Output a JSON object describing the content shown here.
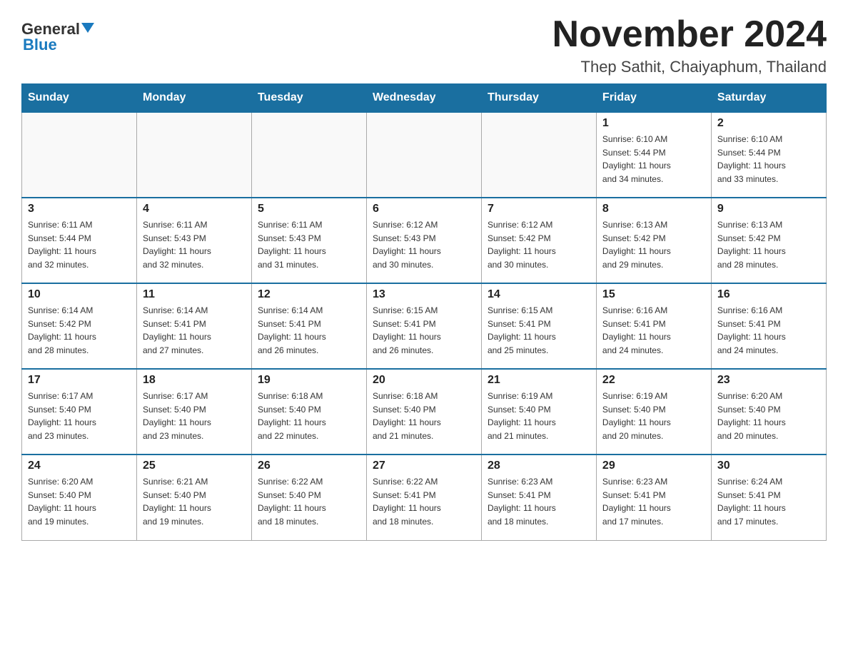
{
  "header": {
    "month_title": "November 2024",
    "location": "Thep Sathit, Chaiyaphum, Thailand",
    "logo_general": "General",
    "logo_blue": "Blue"
  },
  "days_of_week": [
    "Sunday",
    "Monday",
    "Tuesday",
    "Wednesday",
    "Thursday",
    "Friday",
    "Saturday"
  ],
  "weeks": [
    {
      "days": [
        {
          "num": "",
          "info": ""
        },
        {
          "num": "",
          "info": ""
        },
        {
          "num": "",
          "info": ""
        },
        {
          "num": "",
          "info": ""
        },
        {
          "num": "",
          "info": ""
        },
        {
          "num": "1",
          "info": "Sunrise: 6:10 AM\nSunset: 5:44 PM\nDaylight: 11 hours\nand 34 minutes."
        },
        {
          "num": "2",
          "info": "Sunrise: 6:10 AM\nSunset: 5:44 PM\nDaylight: 11 hours\nand 33 minutes."
        }
      ]
    },
    {
      "days": [
        {
          "num": "3",
          "info": "Sunrise: 6:11 AM\nSunset: 5:44 PM\nDaylight: 11 hours\nand 32 minutes."
        },
        {
          "num": "4",
          "info": "Sunrise: 6:11 AM\nSunset: 5:43 PM\nDaylight: 11 hours\nand 32 minutes."
        },
        {
          "num": "5",
          "info": "Sunrise: 6:11 AM\nSunset: 5:43 PM\nDaylight: 11 hours\nand 31 minutes."
        },
        {
          "num": "6",
          "info": "Sunrise: 6:12 AM\nSunset: 5:43 PM\nDaylight: 11 hours\nand 30 minutes."
        },
        {
          "num": "7",
          "info": "Sunrise: 6:12 AM\nSunset: 5:42 PM\nDaylight: 11 hours\nand 30 minutes."
        },
        {
          "num": "8",
          "info": "Sunrise: 6:13 AM\nSunset: 5:42 PM\nDaylight: 11 hours\nand 29 minutes."
        },
        {
          "num": "9",
          "info": "Sunrise: 6:13 AM\nSunset: 5:42 PM\nDaylight: 11 hours\nand 28 minutes."
        }
      ]
    },
    {
      "days": [
        {
          "num": "10",
          "info": "Sunrise: 6:14 AM\nSunset: 5:42 PM\nDaylight: 11 hours\nand 28 minutes."
        },
        {
          "num": "11",
          "info": "Sunrise: 6:14 AM\nSunset: 5:41 PM\nDaylight: 11 hours\nand 27 minutes."
        },
        {
          "num": "12",
          "info": "Sunrise: 6:14 AM\nSunset: 5:41 PM\nDaylight: 11 hours\nand 26 minutes."
        },
        {
          "num": "13",
          "info": "Sunrise: 6:15 AM\nSunset: 5:41 PM\nDaylight: 11 hours\nand 26 minutes."
        },
        {
          "num": "14",
          "info": "Sunrise: 6:15 AM\nSunset: 5:41 PM\nDaylight: 11 hours\nand 25 minutes."
        },
        {
          "num": "15",
          "info": "Sunrise: 6:16 AM\nSunset: 5:41 PM\nDaylight: 11 hours\nand 24 minutes."
        },
        {
          "num": "16",
          "info": "Sunrise: 6:16 AM\nSunset: 5:41 PM\nDaylight: 11 hours\nand 24 minutes."
        }
      ]
    },
    {
      "days": [
        {
          "num": "17",
          "info": "Sunrise: 6:17 AM\nSunset: 5:40 PM\nDaylight: 11 hours\nand 23 minutes."
        },
        {
          "num": "18",
          "info": "Sunrise: 6:17 AM\nSunset: 5:40 PM\nDaylight: 11 hours\nand 23 minutes."
        },
        {
          "num": "19",
          "info": "Sunrise: 6:18 AM\nSunset: 5:40 PM\nDaylight: 11 hours\nand 22 minutes."
        },
        {
          "num": "20",
          "info": "Sunrise: 6:18 AM\nSunset: 5:40 PM\nDaylight: 11 hours\nand 21 minutes."
        },
        {
          "num": "21",
          "info": "Sunrise: 6:19 AM\nSunset: 5:40 PM\nDaylight: 11 hours\nand 21 minutes."
        },
        {
          "num": "22",
          "info": "Sunrise: 6:19 AM\nSunset: 5:40 PM\nDaylight: 11 hours\nand 20 minutes."
        },
        {
          "num": "23",
          "info": "Sunrise: 6:20 AM\nSunset: 5:40 PM\nDaylight: 11 hours\nand 20 minutes."
        }
      ]
    },
    {
      "days": [
        {
          "num": "24",
          "info": "Sunrise: 6:20 AM\nSunset: 5:40 PM\nDaylight: 11 hours\nand 19 minutes."
        },
        {
          "num": "25",
          "info": "Sunrise: 6:21 AM\nSunset: 5:40 PM\nDaylight: 11 hours\nand 19 minutes."
        },
        {
          "num": "26",
          "info": "Sunrise: 6:22 AM\nSunset: 5:40 PM\nDaylight: 11 hours\nand 18 minutes."
        },
        {
          "num": "27",
          "info": "Sunrise: 6:22 AM\nSunset: 5:41 PM\nDaylight: 11 hours\nand 18 minutes."
        },
        {
          "num": "28",
          "info": "Sunrise: 6:23 AM\nSunset: 5:41 PM\nDaylight: 11 hours\nand 18 minutes."
        },
        {
          "num": "29",
          "info": "Sunrise: 6:23 AM\nSunset: 5:41 PM\nDaylight: 11 hours\nand 17 minutes."
        },
        {
          "num": "30",
          "info": "Sunrise: 6:24 AM\nSunset: 5:41 PM\nDaylight: 11 hours\nand 17 minutes."
        }
      ]
    }
  ]
}
